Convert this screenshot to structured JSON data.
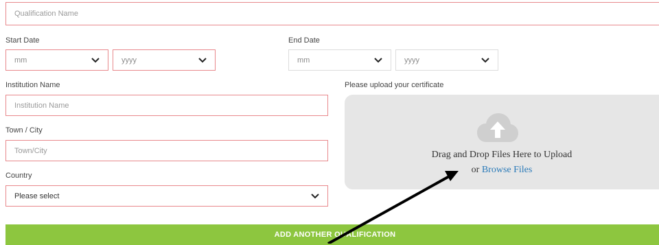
{
  "qualification": {
    "placeholder": "Qualification Name"
  },
  "start_date": {
    "label": "Start Date",
    "month": {
      "value": "mm"
    },
    "year": {
      "value": "yyyy"
    }
  },
  "end_date": {
    "label": "End Date",
    "month": {
      "value": "mm"
    },
    "year": {
      "value": "yyyy"
    }
  },
  "institution": {
    "label": "Institution Name",
    "placeholder": "Institution Name"
  },
  "town": {
    "label": "Town / City",
    "placeholder": "Town/City"
  },
  "country": {
    "label": "Country",
    "value": "Please select"
  },
  "upload": {
    "label": "Please upload your certificate",
    "drag_text": "Drag and Drop Files Here to Upload",
    "or_text": "or ",
    "browse_link": "Browse Files",
    "icon": "cloud-upload-icon"
  },
  "add_button": {
    "label": "ADD ANOTHER QUALIFICATION"
  },
  "colors": {
    "field_border": "#e8888c",
    "button_bg": "#8dc63f",
    "upload_bg": "#e6e6e6",
    "link": "#2a7ab8"
  }
}
